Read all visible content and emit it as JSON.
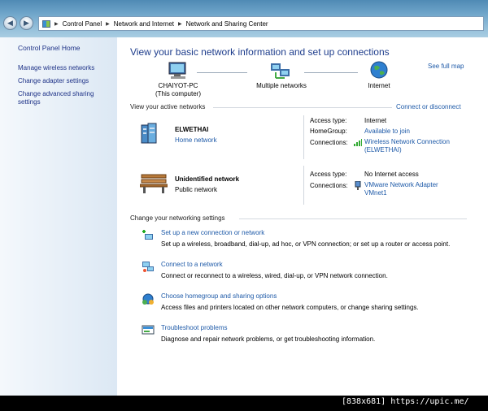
{
  "breadcrumbs": [
    "Control Panel",
    "Network and Internet",
    "Network and Sharing Center"
  ],
  "sidebar": {
    "home": "Control Panel Home",
    "links": [
      "Manage wireless networks",
      "Change adapter settings",
      "Change advanced sharing settings"
    ]
  },
  "main": {
    "title": "View your basic network information and set up connections",
    "see_full_map": "See full map",
    "map": {
      "computer_name": "CHAIYOT-PC",
      "computer_sub": "(This computer)",
      "middle": "Multiple networks",
      "internet": "Internet"
    },
    "active_header": "View your active networks",
    "connect_disconnect": "Connect or disconnect",
    "networks": [
      {
        "name": "ELWETHAI",
        "type": "Home network",
        "access_type_label": "Access type:",
        "access_type": "Internet",
        "homegroup_label": "HomeGroup:",
        "homegroup": "Available to join",
        "connections_label": "Connections:",
        "connection_line1": "Wireless Network Connection",
        "connection_line2": "(ELWETHAI)"
      },
      {
        "name": "Unidentified network",
        "type": "Public network",
        "access_type_label": "Access type:",
        "access_type": "No Internet access",
        "connections_label": "Connections:",
        "connection_line1": "VMware Network Adapter",
        "connection_line2": "VMnet1"
      }
    ],
    "settings_header": "Change your networking settings",
    "tasks": [
      {
        "title": "Set up a new connection or network",
        "desc": "Set up a wireless, broadband, dial-up, ad hoc, or VPN connection; or set up a router or access point."
      },
      {
        "title": "Connect to a network",
        "desc": "Connect or reconnect to a wireless, wired, dial-up, or VPN network connection."
      },
      {
        "title": "Choose homegroup and sharing options",
        "desc": "Access files and printers located on other network computers, or change sharing settings."
      },
      {
        "title": "Troubleshoot problems",
        "desc": "Diagnose and repair network problems, or get troubleshooting information."
      }
    ]
  },
  "footer": "[838x681] https://upic.me/",
  "colors": {
    "link": "#1e5aa8",
    "title": "#1e3d8c",
    "sidebar_link": "#1e3287"
  }
}
